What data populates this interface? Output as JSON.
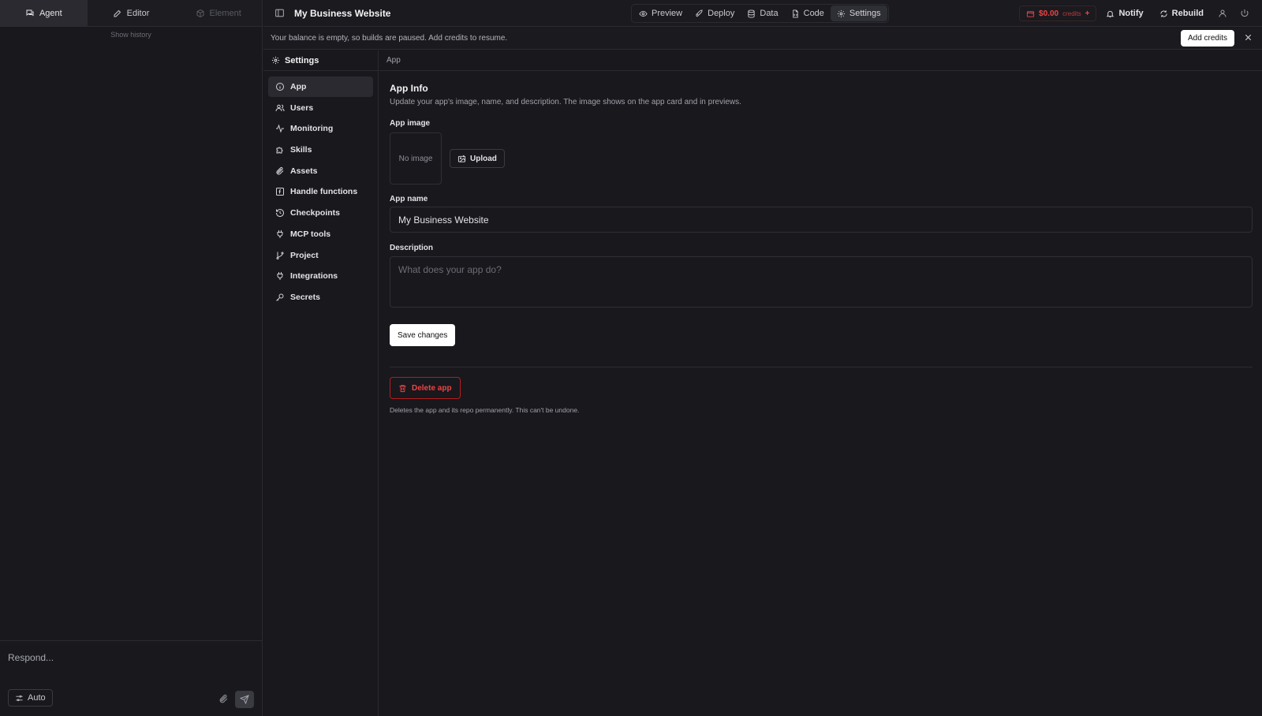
{
  "left_panel": {
    "tabs": [
      {
        "label": "Agent",
        "icon": "chat-icon",
        "state": "active"
      },
      {
        "label": "Editor",
        "icon": "pencil-icon",
        "state": "normal"
      },
      {
        "label": "Element",
        "icon": "cube-icon",
        "state": "disabled"
      }
    ],
    "show_history": "Show history",
    "composer": {
      "placeholder": "Respond...",
      "mode_label": "Auto"
    }
  },
  "topbar": {
    "app_title": "My Business Website",
    "nav": [
      {
        "label": "Preview",
        "icon": "eye-icon"
      },
      {
        "label": "Deploy",
        "icon": "rocket-icon"
      },
      {
        "label": "Data",
        "icon": "database-icon"
      },
      {
        "label": "Code",
        "icon": "file-code-icon"
      },
      {
        "label": "Settings",
        "icon": "gear-icon",
        "active": true
      }
    ],
    "credits_amount": "$0.00",
    "credits_label": "credits",
    "credits_plus": "+",
    "notify_label": "Notify",
    "rebuild_label": "Rebuild"
  },
  "banner": {
    "text": "Your balance is empty, so builds are paused. Add credits to resume.",
    "button_label": "Add credits"
  },
  "settings_sidebar": {
    "title": "Settings",
    "items": [
      {
        "label": "App",
        "icon": "info-icon",
        "active": true
      },
      {
        "label": "Users",
        "icon": "users-icon"
      },
      {
        "label": "Monitoring",
        "icon": "activity-icon"
      },
      {
        "label": "Skills",
        "icon": "puzzle-icon"
      },
      {
        "label": "Assets",
        "icon": "paperclip-icon"
      },
      {
        "label": "Handle functions",
        "icon": "function-icon"
      },
      {
        "label": "Checkpoints",
        "icon": "history-icon"
      },
      {
        "label": "MCP tools",
        "icon": "plug-icon"
      },
      {
        "label": "Project",
        "icon": "git-branch-icon"
      },
      {
        "label": "Integrations",
        "icon": "plug-icon"
      },
      {
        "label": "Secrets",
        "icon": "key-icon"
      }
    ]
  },
  "main": {
    "breadcrumb": "App",
    "section_title": "App Info",
    "section_subtitle": "Update your app's image, name, and description. The image shows on the app card and in previews.",
    "app_image_label": "App image",
    "no_image_text": "No image",
    "upload_label": "Upload",
    "app_name_label": "App name",
    "app_name_value": "My Business Website",
    "description_label": "Description",
    "description_placeholder": "What does your app do?",
    "save_label": "Save changes",
    "delete_label": "Delete app",
    "delete_note": "Deletes the app and its repo permanently. This can't be undone."
  },
  "colors": {
    "background": "#18181d",
    "border": "#2b2b31",
    "danger": "#ef4444",
    "primary_button": "#ffffff"
  }
}
